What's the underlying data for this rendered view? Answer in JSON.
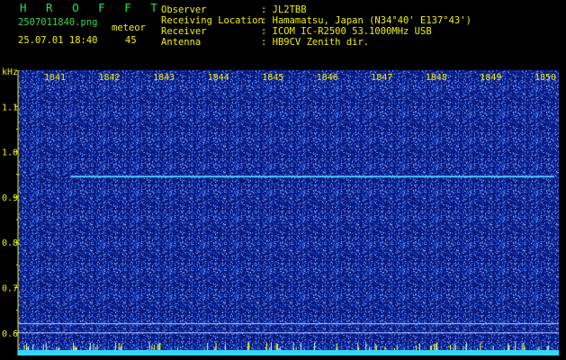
{
  "header": {
    "app_title": "H R O F F T",
    "filename": "2507011840.png",
    "datetime": "25.07.01 18:40",
    "meteor_label": "meteor",
    "meteor_count": "45",
    "fields": [
      {
        "label": "Observer",
        "value": ": JL2TBB"
      },
      {
        "label": "Receiving Location",
        "value": ": Hamamatsu, Japan (N34°40' E137°43')"
      },
      {
        "label": "Receiver",
        "value": ": ICOM IC-R2500 53.1000MHz USB"
      },
      {
        "label": "Antenna",
        "value": ": HB9CV Zenith dir."
      }
    ]
  },
  "colors": {
    "background": "#000000",
    "plot_bg": "#0a1a80",
    "noise": "#3c78ff",
    "signal": "#49c3ff",
    "label": "#f0f000",
    "title": "#27e34a",
    "baseline": "#34d8ff"
  },
  "chart_data": {
    "type": "heatmap",
    "title": "",
    "xlabel": "",
    "ylabel": "kHz",
    "x_ticks": [
      "1841",
      "1842",
      "1843",
      "1844",
      "1845",
      "1846",
      "1847",
      "1848",
      "1849",
      "1850"
    ],
    "y_ticks": [
      "1.1",
      "1.0",
      "0.9",
      "0.8",
      "0.7",
      "0.6"
    ],
    "ylim": [
      0.55,
      1.18
    ],
    "xlim": [
      1841,
      1850
    ],
    "signal_trace": {
      "freq_khz": 0.945,
      "x_start": 1841.3,
      "x_end": 1850
    },
    "reference_lines_khz": [
      0.62,
      0.6
    ],
    "grid": false
  }
}
